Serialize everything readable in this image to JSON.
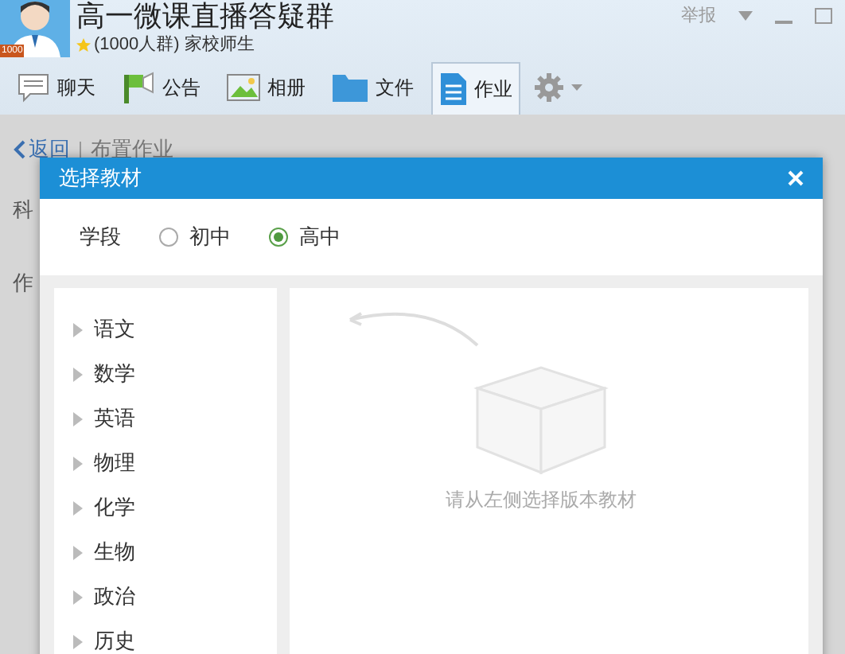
{
  "window": {
    "title": "高一微课直播答疑群",
    "avatar_badge": "1000",
    "subtitle": "(1000人群) 家校师生",
    "report": "举报"
  },
  "toolbar": [
    {
      "label": "聊天",
      "kind": "chat",
      "selected": false
    },
    {
      "label": "公告",
      "kind": "notice",
      "selected": false
    },
    {
      "label": "相册",
      "kind": "album",
      "selected": false
    },
    {
      "label": "文件",
      "kind": "file",
      "selected": false
    },
    {
      "label": "作业",
      "kind": "homework",
      "selected": true
    }
  ],
  "breadcrumb": {
    "back": "返回",
    "current": "布置作业"
  },
  "page_labels": [
    "科",
    "作"
  ],
  "dialog": {
    "title": "选择教材",
    "stage_label": "学段",
    "stages": [
      {
        "label": "初中",
        "selected": false
      },
      {
        "label": "高中",
        "selected": true
      }
    ],
    "subjects": [
      {
        "label": "语文"
      },
      {
        "label": "数学"
      },
      {
        "label": "英语"
      },
      {
        "label": "物理"
      },
      {
        "label": "化学"
      },
      {
        "label": "生物"
      },
      {
        "label": "政治"
      },
      {
        "label": "历史"
      }
    ],
    "empty_message": "请从左侧选择版本教材"
  }
}
